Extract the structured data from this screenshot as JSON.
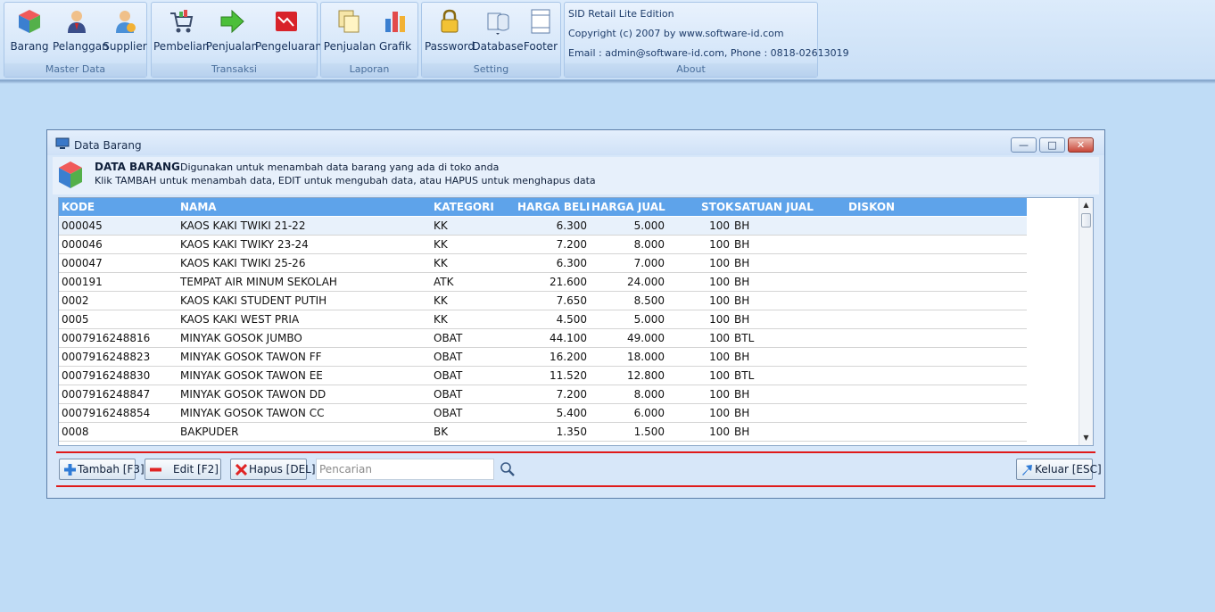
{
  "ribbon": {
    "groups": [
      {
        "caption": "Master Data",
        "buttons": [
          "Barang",
          "Pelanggan",
          "Supplier"
        ]
      },
      {
        "caption": "Transaksi",
        "buttons": [
          "Pembelian",
          "Penjualan",
          "Pengeluaran"
        ]
      },
      {
        "caption": "Laporan",
        "buttons": [
          "Penjualan",
          "Grafik"
        ]
      },
      {
        "caption": "Setting",
        "buttons": [
          "Password",
          "Database",
          "Footer"
        ]
      }
    ],
    "about": {
      "caption": "About",
      "line1": "SID Retail Lite Edition",
      "line2": "Copyright (c) 2007 by www.software-id.com",
      "line3": "Email : admin@software-id.com, Phone : 0818-02613019"
    }
  },
  "window": {
    "title": "Data Barang",
    "header_title": "DATA BARANG",
    "header_desc": "Digunakan untuk menambah data barang yang ada di toko anda",
    "header_line2": "Klik TAMBAH untuk menambah data, EDIT untuk mengubah data, atau HAPUS untuk menghapus data"
  },
  "table": {
    "columns": [
      "KODE",
      "NAMA",
      "KATEGORI",
      "HARGA BELI",
      "HARGA JUAL",
      "STOK",
      "SATUAN JUAL",
      "DISKON"
    ],
    "rows": [
      [
        "000045",
        "KAOS KAKI TWIKI 21-22",
        "KK",
        "6.300",
        "5.000",
        "100",
        "BH",
        ""
      ],
      [
        "000046",
        "KAOS KAKI TWIKY 23-24",
        "KK",
        "7.200",
        "8.000",
        "100",
        "BH",
        ""
      ],
      [
        "000047",
        "KAOS KAKI TWIKI 25-26",
        "KK",
        "6.300",
        "7.000",
        "100",
        "BH",
        ""
      ],
      [
        "000191",
        "TEMPAT AIR MINUM SEKOLAH",
        "ATK",
        "21.600",
        "24.000",
        "100",
        "BH",
        ""
      ],
      [
        "0002",
        "KAOS KAKI STUDENT PUTIH",
        "KK",
        "7.650",
        "8.500",
        "100",
        "BH",
        ""
      ],
      [
        "0005",
        "KAOS KAKI WEST PRIA",
        "KK",
        "4.500",
        "5.000",
        "100",
        "BH",
        ""
      ],
      [
        "0007916248816",
        "MINYAK GOSOK JUMBO",
        "OBAT",
        "44.100",
        "49.000",
        "100",
        "BTL",
        ""
      ],
      [
        "0007916248823",
        "MINYAK GOSOK TAWON FF",
        "OBAT",
        "16.200",
        "18.000",
        "100",
        "BH",
        ""
      ],
      [
        "0007916248830",
        "MINYAK GOSOK TAWON EE",
        "OBAT",
        "11.520",
        "12.800",
        "100",
        "BTL",
        ""
      ],
      [
        "0007916248847",
        "MINYAK GOSOK TAWON DD",
        "OBAT",
        "7.200",
        "8.000",
        "100",
        "BH",
        ""
      ],
      [
        "0007916248854",
        "MINYAK GOSOK TAWON CC",
        "OBAT",
        "5.400",
        "6.000",
        "100",
        "BH",
        ""
      ],
      [
        "0008",
        "BAKPUDER",
        "BK",
        "1.350",
        "1.500",
        "100",
        "BH",
        ""
      ]
    ]
  },
  "toolbar": {
    "add_label": "Tambah [F3]",
    "edit_label": "Edit [F2]",
    "delete_label": "Hapus [DEL]",
    "search_placeholder": "Pencarian",
    "search_value": "",
    "exit_label": "Keluar [ESC]"
  },
  "colors": {
    "grid_header": "#5ea3ea",
    "accent_line": "#e01a1a",
    "desktop": "#bfdcf6"
  }
}
